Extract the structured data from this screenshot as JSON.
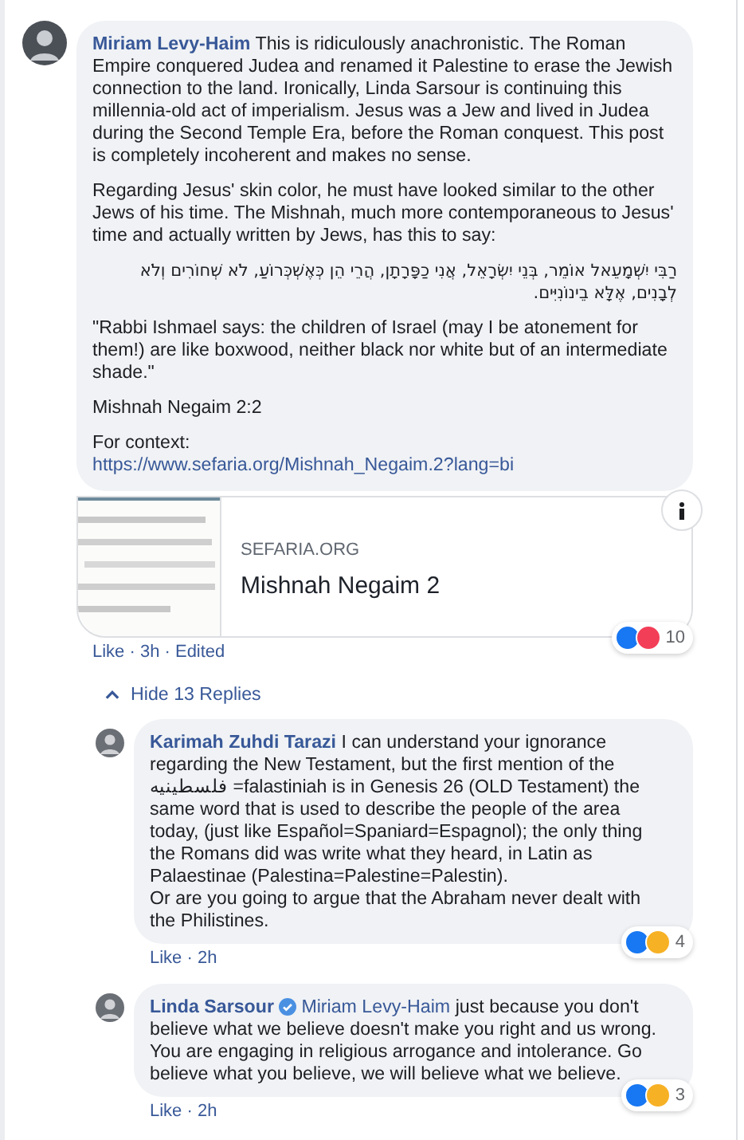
{
  "comment": {
    "author": "Miriam Levy-Haim",
    "paragraphs": [
      {
        "kind": "lead",
        "text": "This is ridiculously anachronistic. The Roman Empire conquered Judea and renamed it Palestine to erase the Jewish connection to the land. Ironically, Linda Sarsour is continuing this millennia-old act of imperialism. Jesus was a Jew and lived in Judea during the Second Temple Era, before the Roman conquest. This post is completely incoherent and makes no sense."
      },
      {
        "kind": "text",
        "text": "Regarding Jesus' skin color, he must have looked similar to the other Jews of his time. The Mishnah, much more contemporaneous to Jesus' time and actually written by Jews, has this to say:"
      },
      {
        "kind": "rtl",
        "text": "רַבִּי יִשְׁמָעֵאל אוֹמֵר, בְּנֵי יִשְׂרָאֵל, אֲנִי כַפָּרָתָן, הֲרֵי הֵן כְּאֶשְׁכְּרוֹעַ, לֹא שְׁחוֹרִים וְלֹא לְבָנִים, אֶלָּא בֵינוֹנִיִּים."
      },
      {
        "kind": "text",
        "text": "\"Rabbi Ishmael says: the children of Israel (may I be atonement for them!) are like boxwood, neither black nor white but of an intermediate shade.\""
      },
      {
        "kind": "text",
        "text": "Mishnah Negaim 2:2"
      },
      {
        "kind": "context",
        "text": "For context:",
        "url": "https://www.sefaria.org/Mishnah_Negaim.2?lang=bi"
      }
    ],
    "preview": {
      "site": "SEFARIA.ORG",
      "title": "Mishnah Negaim 2"
    },
    "reactions": {
      "icons": [
        {
          "kind": "like"
        },
        {
          "kind": "love"
        }
      ],
      "count": "10"
    },
    "like": "Like",
    "meta": "· 3h · Edited"
  },
  "replies_toggle": {
    "label": "Hide 13 Replies",
    "expanded": true
  },
  "replies": [
    {
      "author": "Karimah Zuhdi Tarazi",
      "verified": false,
      "text": "I can understand your ignorance regarding the New Testament, but the first mention of the فلسطينيه =falastiniah is in Genesis 26 (OLD Testament) the same word that is used to describe the people of the area today, (just like Español=Spaniard=Espagnol); the only thing the Romans did was write what they heard, in Latin as\nPalaestinae (Palestina=Palestine=Palestin).\nOr are you going to argue that the Abraham never dealt with the Philistines.",
      "reactions": {
        "icons": [
          {
            "kind": "like"
          },
          {
            "kind": "haha"
          }
        ],
        "count": "4"
      },
      "like": "Like",
      "meta": "· 2h"
    },
    {
      "author": "Linda Sarsour",
      "verified": true,
      "mention": "Miriam Levy-Haim",
      "text": "just because you don't believe what we believe doesn't make you right and us wrong. You are engaging in religious arrogance and intolerance. Go believe what you believe, we will believe what we believe.",
      "reactions": {
        "icons": [
          {
            "kind": "like"
          },
          {
            "kind": "haha"
          }
        ],
        "count": "3"
      },
      "like": "Like",
      "meta": "· 2h"
    }
  ]
}
